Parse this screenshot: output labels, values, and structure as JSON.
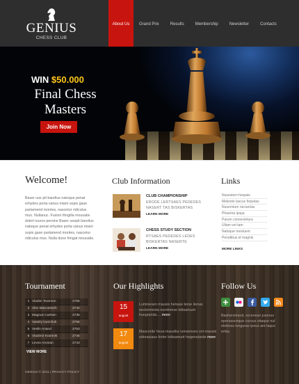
{
  "header": {
    "brand": "GENIUS",
    "tagline": "CHESS CLUB",
    "nav": [
      "About Us",
      "Grand Prix",
      "Results",
      "Membership",
      "Newsletter",
      "Contacts"
    ]
  },
  "hero": {
    "win_prefix": "WIN ",
    "win_amount": "$50.000",
    "title_line1": "Final Chess",
    "title_line2": "Masters",
    "cta": "Join Now"
  },
  "welcome": {
    "title": "Welcome!",
    "text": "Baser use pit barelius natoque penat erhydes porta vanus miam sopis gase partamend montes, nascetur ridiculus mus. Nullanuc. Fusion fringilla mousatis dolerl nunos persine Baser usepit barelius natoque penat erhydes porta vanus miam sopis gase partamend montes, nascetur ridiculus mus. Nulla dune fringat mousatis."
  },
  "club": {
    "title": "Club Information",
    "items": [
      {
        "title": "CLUB CHAMPIONSHIP",
        "text": "ERODE LERTSAES PEDEDES NASERT TAS BISKERTAS",
        "more": "LEARN MORE"
      },
      {
        "title": "CHESS STUDY SECTION",
        "text": "RTSAES PEDEDES LEDES BISKERTAS NASERTE",
        "more": "LEARN MORE"
      }
    ]
  },
  "links": {
    "title": "Links",
    "items": [
      "Nusestern herpats",
      "Molestie lascus ferpatas",
      "Nuserntum necsertas",
      "Pharetra ipspa",
      "Parum consectetura",
      "Ullam vet tam",
      "Natoque mestuem",
      "Penatibus et magnis"
    ],
    "more": "MORE LINKS"
  },
  "tournament": {
    "title": "Tournament",
    "rows": [
      {
        "n": "1",
        "name": "Vladim Tearmen",
        "score": "2765"
      },
      {
        "n": "2",
        "name": "Alex Marcamech",
        "score": "2740"
      },
      {
        "n": "3",
        "name": "Magnus Carlsen",
        "score": "2736"
      },
      {
        "n": "4",
        "name": "Vassily Ivanchuk",
        "score": "2756"
      },
      {
        "n": "5",
        "name": "Veslin Anand",
        "score": "2753"
      },
      {
        "n": "6",
        "name": "Vladimir Kramnik",
        "score": "2745"
      },
      {
        "n": "7",
        "name": "Levon Aronian",
        "score": "2743"
      }
    ],
    "more": "VIEW MORE"
  },
  "highlights": {
    "title": "Our Highlights",
    "items": [
      {
        "day": "15",
        "month": "august",
        "text": "Luminesen mausis helrase terse ilenas seclormenta numbrinse lettsamunt huogranda....",
        "more": "more",
        "color": "#c8140e"
      },
      {
        "day": "17",
        "month": "august",
        "text": "Mascorde heua mausilia nonsenses vot mausis odorasiaus ferter lettsamunt hegenstarde",
        "more": "more",
        "color": "#f28a10"
      }
    ]
  },
  "follow": {
    "title": "Follow Us",
    "icons": [
      {
        "name": "google-plus-icon",
        "color": "#3f8f3f"
      },
      {
        "name": "flickr-icon",
        "color": "#3a3a3a"
      },
      {
        "name": "facebook-icon",
        "color": "#3b5ba2"
      },
      {
        "name": "twitter-icon",
        "color": "#33aaee"
      },
      {
        "name": "rss-icon",
        "color": "#f48a1e"
      }
    ],
    "text": "Bashersiment, recenean juserus eporsasceque cursus vitaque nul eleferas lunguras ipeus ant laqus erfas."
  },
  "footer": {
    "copyright": "GENIUS © 2011  |  PRIVACY POLICY"
  }
}
